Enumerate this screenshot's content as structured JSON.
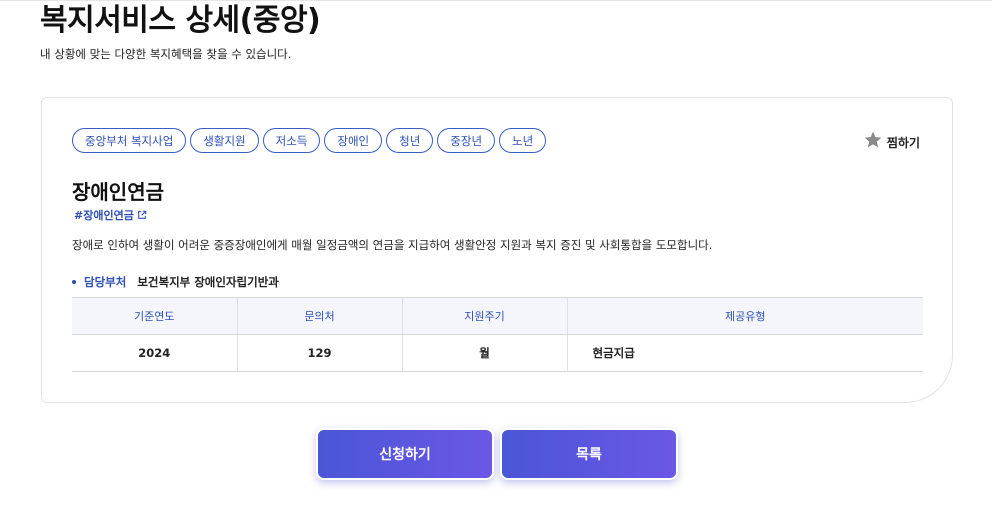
{
  "header": {
    "title": "복지서비스 상세(중앙)",
    "subtitle": "내 상황에 맞는 다양한 복지혜택을 찾을 수 있습니다."
  },
  "card": {
    "tags": [
      "중앙부처 복지사업",
      "생활지원",
      "저소득",
      "장애인",
      "청년",
      "중장년",
      "노년"
    ],
    "favorite_label": "찜하기",
    "service_title": "장애인연금",
    "hashtag": "#장애인연금",
    "description": "장애로 인하여 생활이 어려운 중증장애인에게 매월 일정금액의 연금을 지급하여 생활안정 지원과 복지 증진 및 사회통합을 도모합니다.",
    "department_label": "담당부처",
    "department_value": "보건복지부 장애인자립기반과",
    "table": {
      "headers": [
        "기준연도",
        "문의처",
        "지원주기",
        "제공유형"
      ],
      "row": [
        "2024",
        "129",
        "월",
        "현금지급"
      ]
    }
  },
  "buttons": {
    "apply_label": "신청하기",
    "list_label": "목록"
  },
  "colors": {
    "accent": "#2d4fb5",
    "button_start": "#4a56d6",
    "button_end": "#6b57e6",
    "star": "#8a8a8a"
  }
}
